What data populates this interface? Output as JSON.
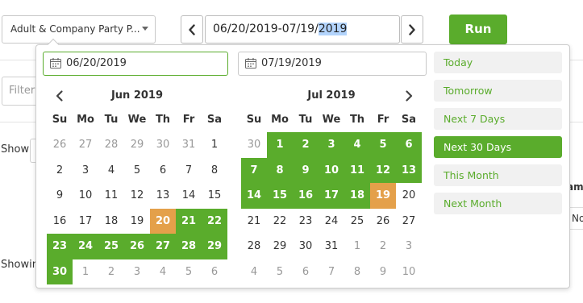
{
  "toolbar": {
    "report_select": "Adult & Company Party P...",
    "date_range_prefix": "06/20/2019-07/19/",
    "date_range_selected": "2019",
    "run_label": "Run"
  },
  "background": {
    "filter_text": "Filter",
    "show_label": "Show",
    "showing_label": "Showing",
    "column_header_fragment": "ame",
    "cell_fragment": "No"
  },
  "picker": {
    "start_date": "06/20/2019",
    "end_date": "07/19/2019",
    "weekdays": [
      "Su",
      "Mo",
      "Tu",
      "We",
      "Th",
      "Fr",
      "Sa"
    ],
    "left_month": {
      "title": "Jun 2019",
      "days": [
        [
          "26",
          "off"
        ],
        [
          "27",
          "off"
        ],
        [
          "28",
          "off"
        ],
        [
          "29",
          "off"
        ],
        [
          "30",
          "off"
        ],
        [
          "31",
          "off"
        ],
        [
          "1",
          ""
        ],
        [
          "2",
          ""
        ],
        [
          "3",
          ""
        ],
        [
          "4",
          ""
        ],
        [
          "5",
          ""
        ],
        [
          "6",
          ""
        ],
        [
          "7",
          ""
        ],
        [
          "8",
          ""
        ],
        [
          "9",
          ""
        ],
        [
          "10",
          ""
        ],
        [
          "11",
          ""
        ],
        [
          "12",
          ""
        ],
        [
          "13",
          ""
        ],
        [
          "14",
          ""
        ],
        [
          "15",
          ""
        ],
        [
          "16",
          ""
        ],
        [
          "17",
          ""
        ],
        [
          "18",
          ""
        ],
        [
          "19",
          ""
        ],
        [
          "20",
          "edge"
        ],
        [
          "21",
          "in"
        ],
        [
          "22",
          "in"
        ],
        [
          "23",
          "in"
        ],
        [
          "24",
          "in"
        ],
        [
          "25",
          "in"
        ],
        [
          "26",
          "in"
        ],
        [
          "27",
          "in"
        ],
        [
          "28",
          "in"
        ],
        [
          "29",
          "in"
        ],
        [
          "30",
          "in"
        ],
        [
          "1",
          "off"
        ],
        [
          "2",
          "off"
        ],
        [
          "3",
          "off"
        ],
        [
          "4",
          "off"
        ],
        [
          "5",
          "off"
        ],
        [
          "6",
          "off"
        ]
      ]
    },
    "right_month": {
      "title": "Jul 2019",
      "days": [
        [
          "30",
          "off"
        ],
        [
          "1",
          "in"
        ],
        [
          "2",
          "in"
        ],
        [
          "3",
          "in"
        ],
        [
          "4",
          "in"
        ],
        [
          "5",
          "in"
        ],
        [
          "6",
          "in"
        ],
        [
          "7",
          "in"
        ],
        [
          "8",
          "in"
        ],
        [
          "9",
          "in"
        ],
        [
          "10",
          "in"
        ],
        [
          "11",
          "in"
        ],
        [
          "12",
          "in"
        ],
        [
          "13",
          "in"
        ],
        [
          "14",
          "in"
        ],
        [
          "15",
          "in"
        ],
        [
          "16",
          "in"
        ],
        [
          "17",
          "in"
        ],
        [
          "18",
          "in"
        ],
        [
          "19",
          "edge"
        ],
        [
          "20",
          ""
        ],
        [
          "21",
          ""
        ],
        [
          "22",
          ""
        ],
        [
          "23",
          ""
        ],
        [
          "24",
          ""
        ],
        [
          "25",
          ""
        ],
        [
          "26",
          ""
        ],
        [
          "27",
          ""
        ],
        [
          "28",
          ""
        ],
        [
          "29",
          ""
        ],
        [
          "30",
          ""
        ],
        [
          "31",
          ""
        ],
        [
          "1",
          "off"
        ],
        [
          "2",
          "off"
        ],
        [
          "3",
          "off"
        ],
        [
          "4",
          "off"
        ],
        [
          "5",
          "off"
        ],
        [
          "6",
          "off"
        ],
        [
          "7",
          "off"
        ],
        [
          "8",
          "off"
        ],
        [
          "9",
          "off"
        ],
        [
          "10",
          "off"
        ]
      ]
    },
    "ranges": [
      {
        "label": "Today",
        "active": false
      },
      {
        "label": "Tomorrow",
        "active": false
      },
      {
        "label": "Next 7 Days",
        "active": false
      },
      {
        "label": "Next 30 Days",
        "active": true
      },
      {
        "label": "This Month",
        "active": false
      },
      {
        "label": "Next Month",
        "active": false
      }
    ]
  },
  "colors": {
    "accent": "#5aac2c",
    "range_endpoint": "#e4a04a",
    "selection_highlight": "#b3d4fc"
  },
  "icons": {
    "calendar": "calendar-icon",
    "prev": "chevron-left-icon",
    "next": "chevron-right-icon",
    "caret": "caret-down-icon"
  }
}
